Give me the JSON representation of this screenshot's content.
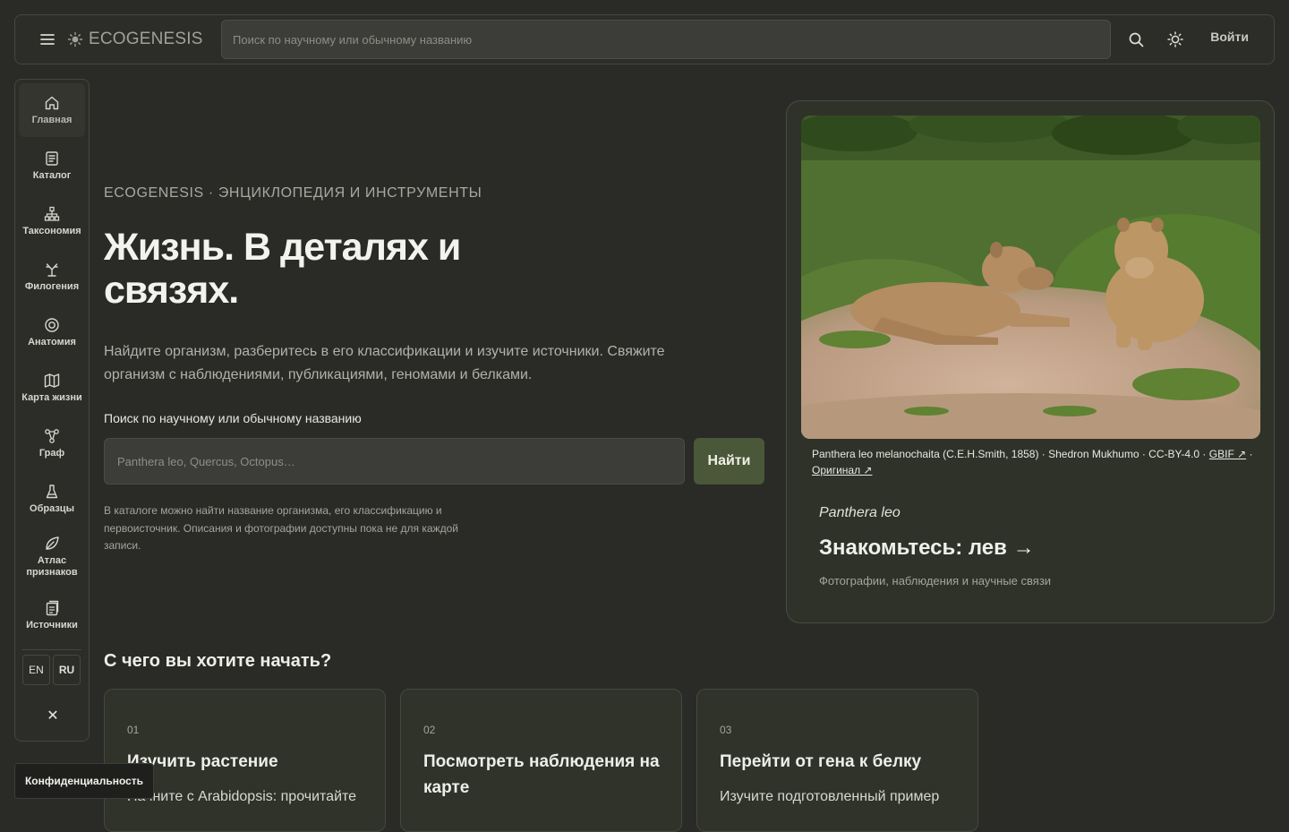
{
  "header": {
    "brand": "ECOGENESIS",
    "search_placeholder": "Поиск по научному или обычному названию",
    "login_label": "Войти"
  },
  "sidebar": {
    "items": [
      {
        "label": "Главная",
        "icon": "home-icon"
      },
      {
        "label": "Каталог",
        "icon": "catalog-icon"
      },
      {
        "label": "Таксономия",
        "icon": "taxonomy-icon"
      },
      {
        "label": "Филогения",
        "icon": "phylogeny-icon"
      },
      {
        "label": "Анатомия",
        "icon": "anatomy-icon"
      },
      {
        "label": "Карта жизни",
        "icon": "map-icon"
      },
      {
        "label": "Граф",
        "icon": "graph-icon"
      },
      {
        "label": "Образцы",
        "icon": "flask-icon"
      },
      {
        "label": "Атлас признаков",
        "icon": "leaf-icon"
      },
      {
        "label": "Источники",
        "icon": "sources-icon"
      }
    ],
    "lang_en": "EN",
    "lang_ru": "RU",
    "close_symbol": "✕"
  },
  "hero": {
    "eyebrow": "ECOGENESIS · ЭНЦИКЛОПЕДИЯ И ИНСТРУМЕНТЫ",
    "title": "Жизнь. В деталях и связях.",
    "description": "Найдите организм, разберитесь в его классификации и изучите источники. Свяжите организм с наблюдениями, публикациями, геномами и белками.",
    "search_label": "Поиск по научному или обычному названию",
    "search_placeholder": "Panthera leo, Quercus, Octopus…",
    "find_label": "Найти",
    "hint": "В каталоге можно найти название организма, его классификацию и первоисточник. Описания и фотографии доступны пока не для каждой записи."
  },
  "feature": {
    "caption_text": "Panthera leo melanochaita (C.E.H.Smith, 1858) · Shedron Mukhumo · CC-BY-4.0 · ",
    "caption_link_gbif": "GBIF ↗",
    "caption_sep": " · ",
    "caption_link_original": "Оригинал ↗",
    "scientific_name": "Panthera leo",
    "meet_label": "Знакомьтесь: лев →",
    "subtitle": "Фотографии, наблюдения и научные связи"
  },
  "start": {
    "title": "С чего вы хотите начать?",
    "cards": [
      {
        "num": "01",
        "title": "Изучить растение",
        "desc": "Начните с Arabidopsis: прочитайте"
      },
      {
        "num": "02",
        "title": "Посмотреть наблюдения на карте",
        "desc": ""
      },
      {
        "num": "03",
        "title": "Перейти от гена к белку",
        "desc": "Изучите подготовленный пример"
      }
    ]
  },
  "privacy_label": "Конфиденциальность",
  "colors": {
    "background": "#2a2a27",
    "accent_button": "#4a5738",
    "card_bg": "#2f3229"
  }
}
